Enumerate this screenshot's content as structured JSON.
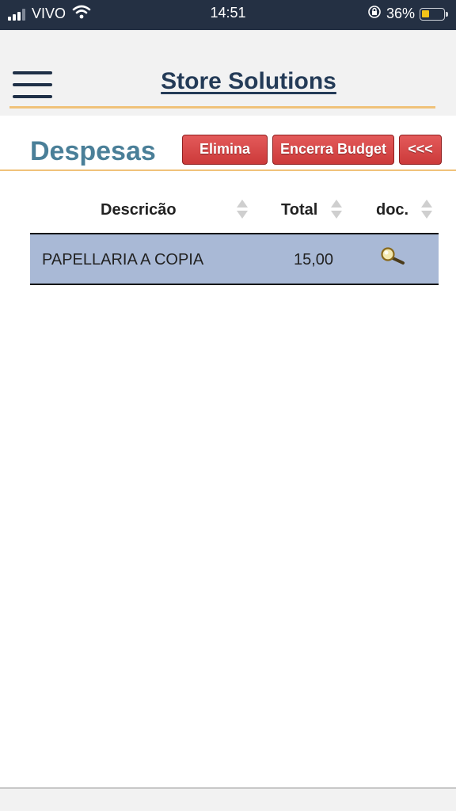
{
  "status_bar": {
    "carrier": "VIVO",
    "time": "14:51",
    "battery": "36%"
  },
  "header": {
    "title": "Store Solutions"
  },
  "toolbar": {
    "title": "Despesas",
    "elimina_label": "Elimina",
    "encerra_label": "Encerra Budget",
    "back_label": "<<<"
  },
  "table": {
    "columns": [
      "Descricão",
      "Total",
      "doc."
    ],
    "rows": [
      {
        "description": "PAPELLARIA A COPIA",
        "total": "15,00",
        "doc_icon": "magnifier-icon"
      }
    ]
  },
  "colors": {
    "status_bar_bg": "#243043",
    "title": "#243b57",
    "accent_line": "#f0c27a",
    "page_title": "#4a7f98",
    "button": "#d94545",
    "row_bg": "#a9b9d6"
  }
}
